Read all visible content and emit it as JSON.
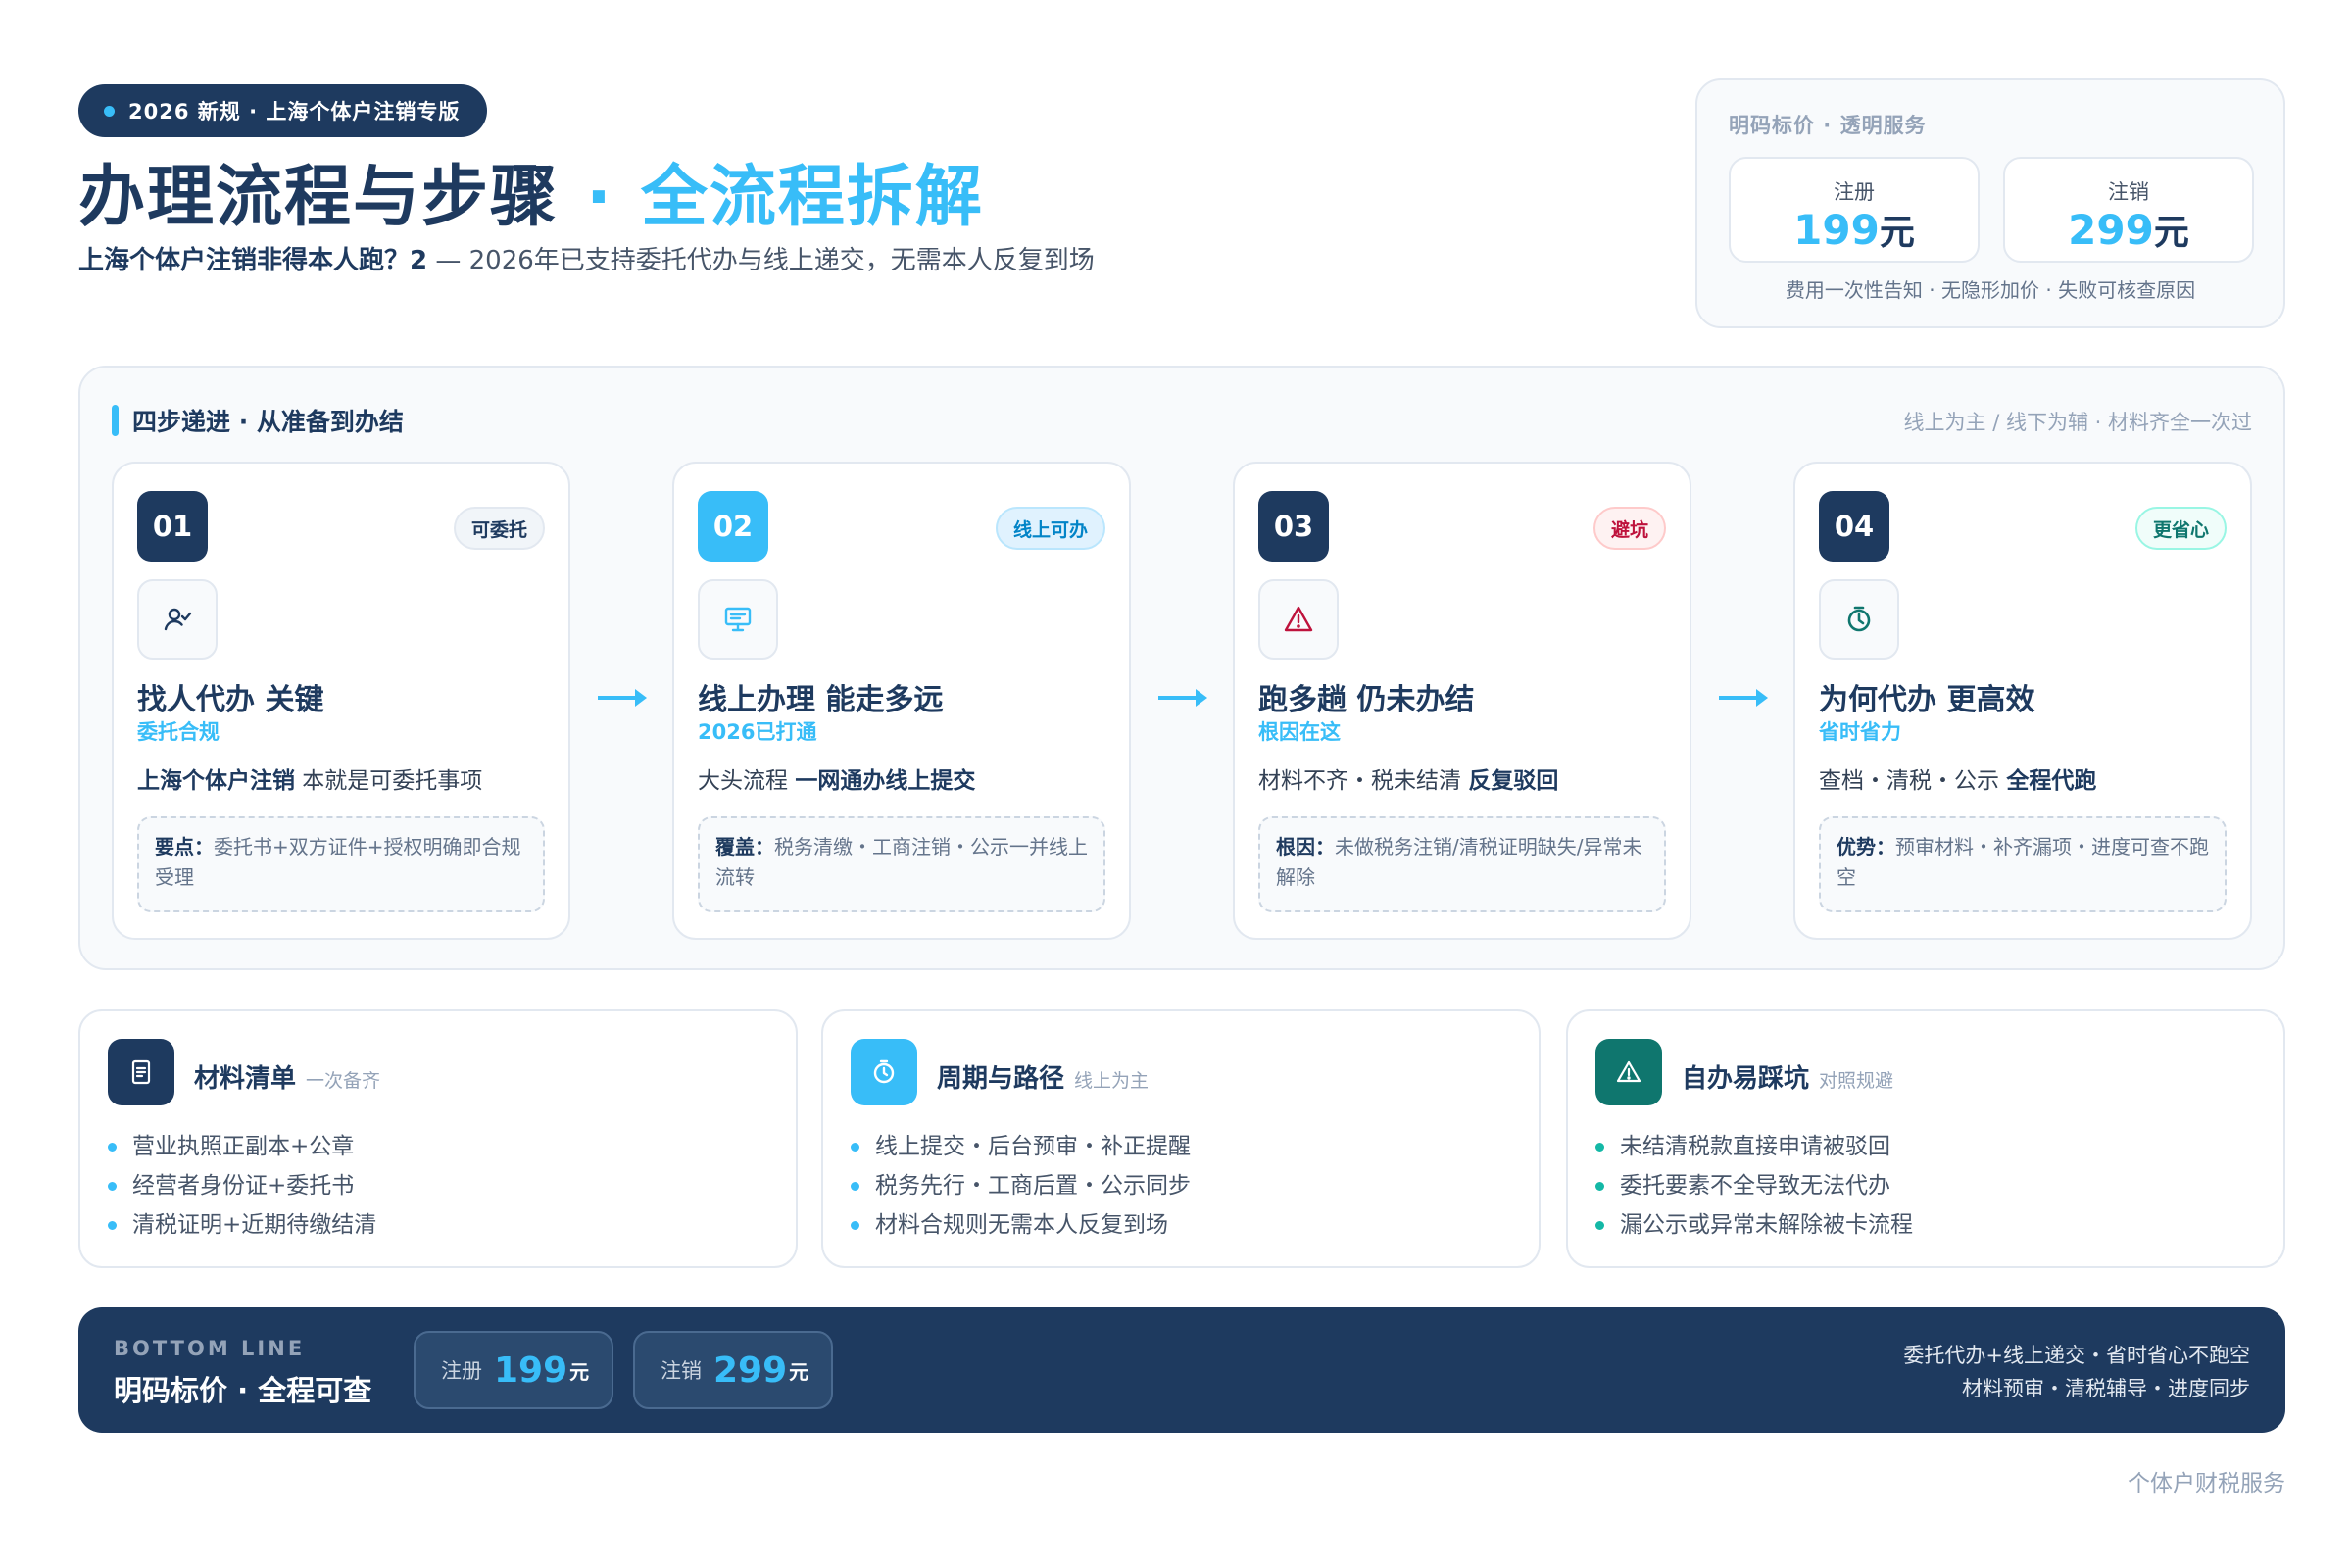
{
  "header": {
    "tag": "2026 新规 · 上海个体户注销专版",
    "title_main": "办理流程与步骤",
    "title_sep": "·",
    "title_accent": "全流程拆解",
    "subtitle_strong": "上海个体户注销非得本人跑？2",
    "subtitle_rest": " — 2026年已支持委托代办与线上递交，无需本人反复到场"
  },
  "price_box": {
    "head": "明码标价 · 透明服务",
    "cards": [
      {
        "label": "注册",
        "value": "199",
        "unit": "元"
      },
      {
        "label": "注销",
        "value": "299",
        "unit": "元"
      }
    ],
    "foot": "费用一次性告知 · 无隐形加价 · 失败可核查原因"
  },
  "steps_panel": {
    "title": "四步递进 · 从准备到办结",
    "right_note": "线上为主 / 线下为辅 · 材料齐全一次过",
    "steps": [
      {
        "num": "01",
        "badge": "可委托",
        "icon": "user-check-icon",
        "title": "找人代办 关键",
        "sub": "委托合规",
        "line_bold": "上海个体户注销",
        "line_rest": " 本就是可委托事项",
        "note_label": "要点：",
        "note_text": "委托书+双方证件+授权明确即合规受理"
      },
      {
        "num": "02",
        "badge": "线上可办",
        "icon": "monitor-icon",
        "title": "线上办理 能走多远",
        "sub": "2026已打通",
        "line_pre": "大头流程 ",
        "line_bold": "一网通办线上提交",
        "note_label": "覆盖：",
        "note_text": "税务清缴・工商注销・公示一并线上流转"
      },
      {
        "num": "03",
        "badge": "避坑",
        "icon": "warning-icon",
        "title": "跑多趟 仍未办结",
        "sub": "根因在这",
        "line_pre": "材料不齐・税未结清 ",
        "line_bold": "反复驳回",
        "note_label": "根因：",
        "note_text": "未做税务注销/清税证明缺失/异常未解除"
      },
      {
        "num": "04",
        "badge": "更省心",
        "icon": "clock-icon",
        "title": "为何代办 更高效",
        "sub": "省时省力",
        "line_pre": "查档・清税・公示 ",
        "line_bold": "全程代跑",
        "note_label": "优势：",
        "note_text": "预审材料・补齐漏项・进度可查不跑空"
      }
    ]
  },
  "info_cards": [
    {
      "icon": "document-icon",
      "title": "材料清单",
      "small": "一次备齐",
      "color": "#1e3a5f",
      "items": [
        "营业执照正副本+公章",
        "经营者身份证+委托书",
        "清税证明+近期待缴结清"
      ]
    },
    {
      "icon": "clock-icon",
      "title": "周期与路径",
      "small": "线上为主",
      "color": "#38bdf8",
      "items": [
        "线上提交・后台预审・补正提醒",
        "税务先行・工商后置・公示同步",
        "材料合规则无需本人反复到场"
      ]
    },
    {
      "icon": "warning-icon",
      "title": "自办易踩坑",
      "small": "对照规避",
      "color": "#0f766e",
      "items": [
        "未结清税款直接申请被驳回",
        "委托要素不全导致无法代办",
        "漏公示或异常未解除被卡流程"
      ]
    }
  ],
  "bottom_bar": {
    "caption": "BOTTOM LINE",
    "main": "明码标价 · 全程可查",
    "prices": [
      {
        "label": "注册",
        "value": "199",
        "unit": "元"
      },
      {
        "label": "注销",
        "value": "299",
        "unit": "元"
      }
    ],
    "right_line1": "委托代办+线上递交・省时省心不跑空",
    "right_line2": "材料预审・清税辅导・进度同步"
  },
  "footer_note": "个体户财税服务"
}
